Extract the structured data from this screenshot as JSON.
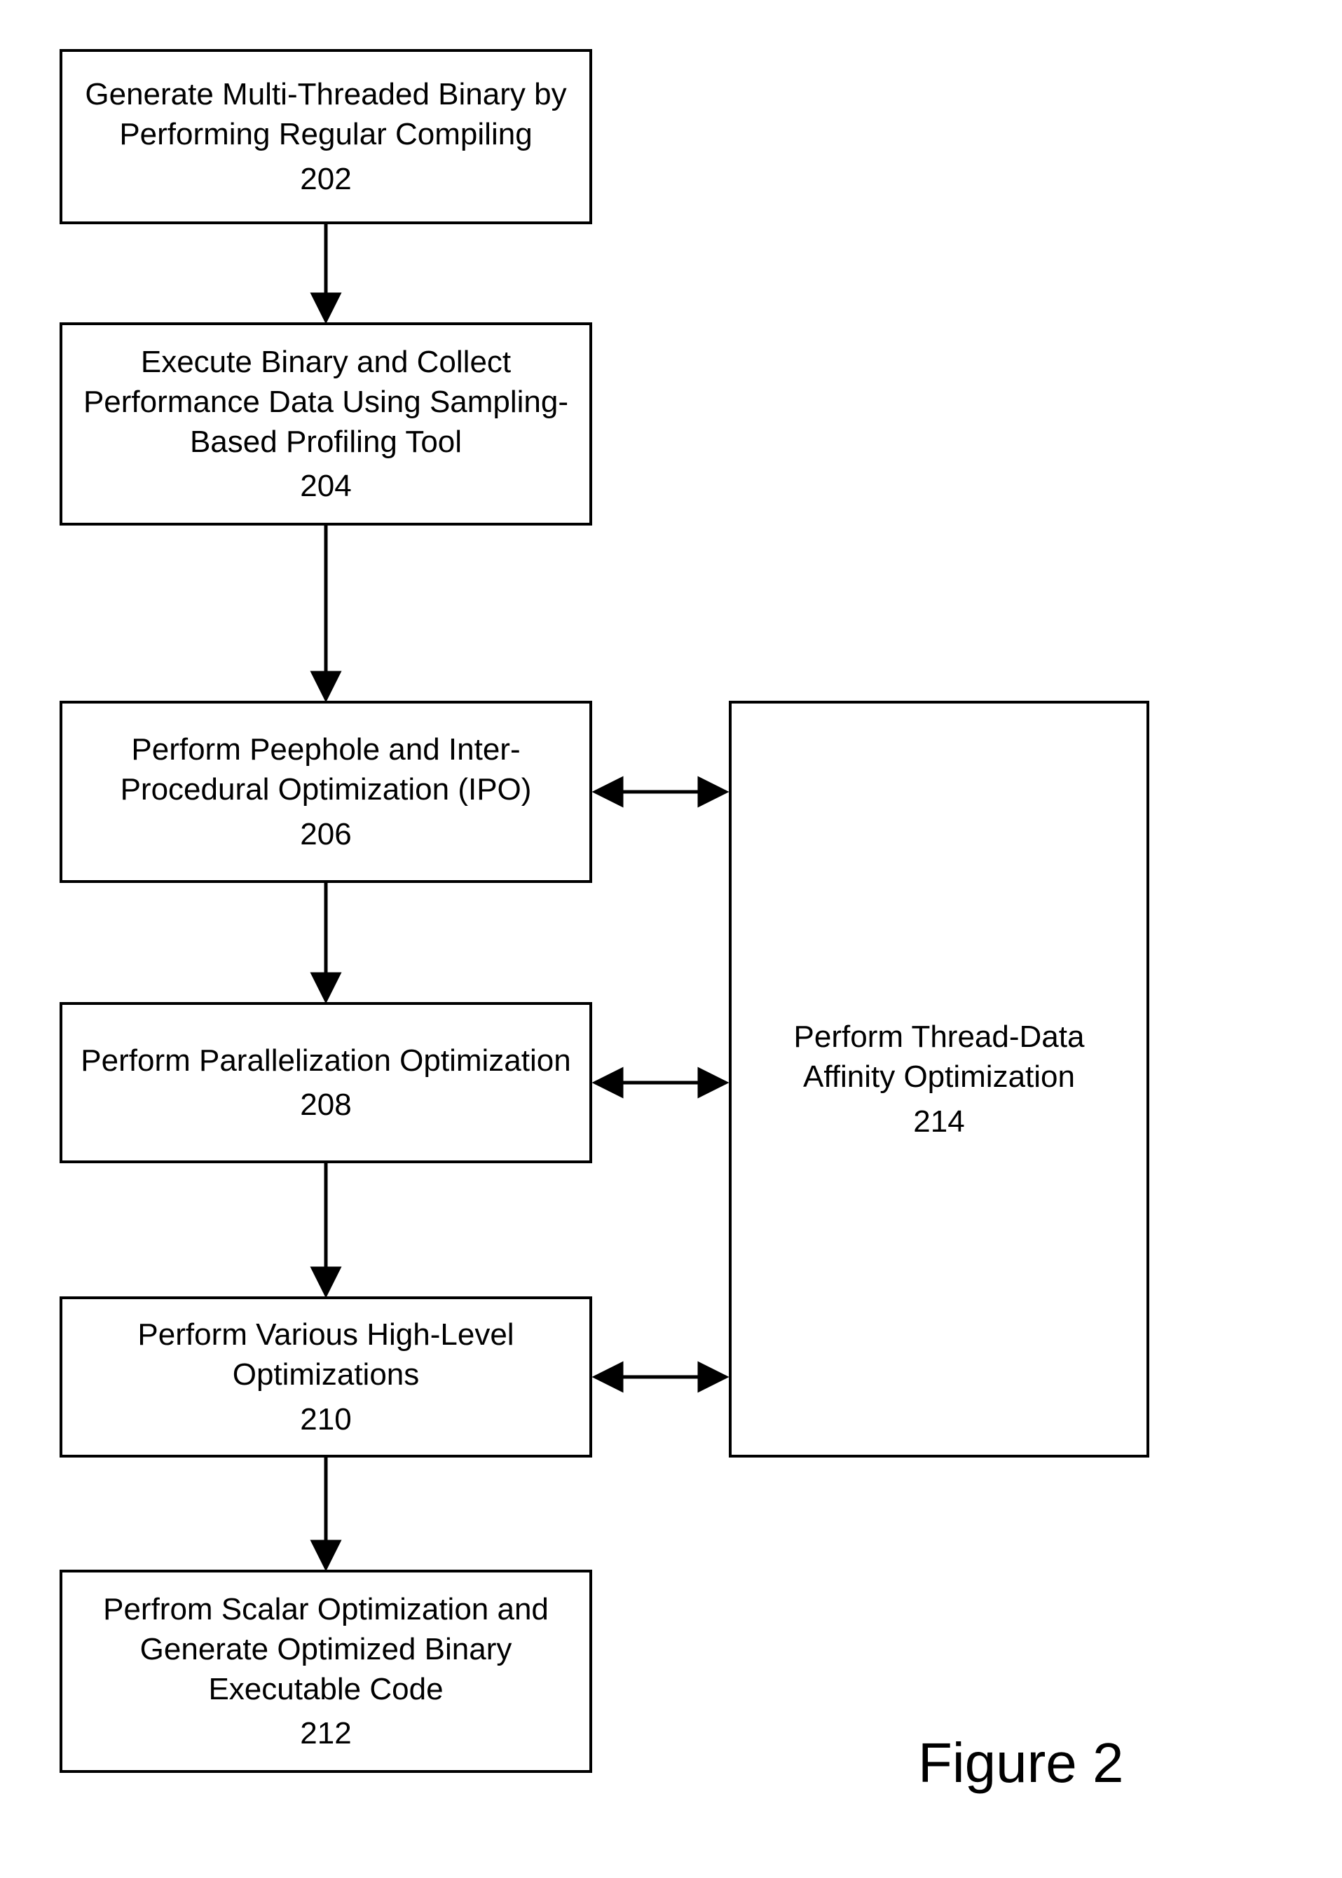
{
  "figure_label": "Figure 2",
  "boxes": {
    "b202": {
      "text": "Generate Multi-Threaded Binary by Performing Regular Compiling",
      "num": "202"
    },
    "b204": {
      "text": "Execute Binary and Collect Performance Data Using Sampling-Based Profiling Tool",
      "num": "204"
    },
    "b206": {
      "text": "Perform Peephole and Inter-Procedural Optimization (IPO)",
      "num": "206"
    },
    "b208": {
      "text": "Perform Parallelization Optimization",
      "num": "208"
    },
    "b210": {
      "text": "Perform Various High-Level Optimizations",
      "num": "210"
    },
    "b212": {
      "text": "Perfrom Scalar Optimization and Generate Optimized Binary Executable Code",
      "num": "212"
    },
    "b214": {
      "text": "Perform Thread-Data Affinity Optimization",
      "num": "214"
    }
  },
  "flow_edges": [
    {
      "from": "b202",
      "to": "b204",
      "type": "down"
    },
    {
      "from": "b204",
      "to": "b206",
      "type": "down"
    },
    {
      "from": "b206",
      "to": "b208",
      "type": "down"
    },
    {
      "from": "b208",
      "to": "b210",
      "type": "down"
    },
    {
      "from": "b210",
      "to": "b212",
      "type": "down"
    },
    {
      "from": "b206",
      "to": "b214",
      "type": "bidir-horiz"
    },
    {
      "from": "b208",
      "to": "b214",
      "type": "bidir-horiz"
    },
    {
      "from": "b210",
      "to": "b214",
      "type": "bidir-horiz"
    }
  ]
}
